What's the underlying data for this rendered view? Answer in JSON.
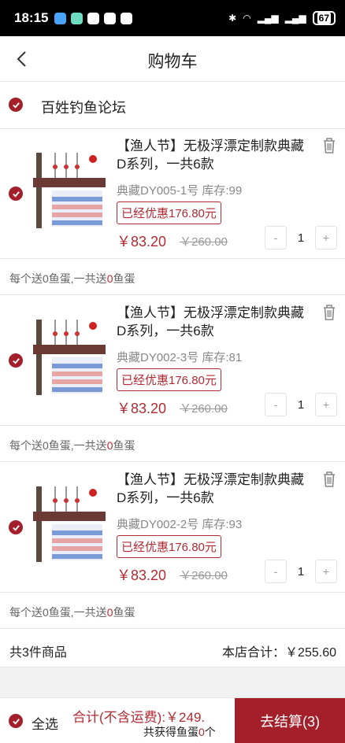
{
  "status_bar": {
    "time": "18:15",
    "battery": "67"
  },
  "header": {
    "title": "购物车"
  },
  "shop": {
    "name": "百姓钓鱼论坛"
  },
  "items": [
    {
      "title": "【渔人节】无极浮漂定制款典藏D系列，一共6款",
      "sku": "典藏DY005-1号 库存:99",
      "discount": "已经优惠176.80元",
      "price": "￥83.20",
      "original_price": "￥260.00",
      "quantity": "1",
      "note_prefix": "每个送0鱼蛋,一共送",
      "note_count": "0",
      "note_suffix": "鱼蛋"
    },
    {
      "title": "【渔人节】无极浮漂定制款典藏D系列，一共6款",
      "sku": "典藏DY002-3号 库存:81",
      "discount": "已经优惠176.80元",
      "price": "￥83.20",
      "original_price": "￥260.00",
      "quantity": "1",
      "note_prefix": "每个送0鱼蛋,一共送",
      "note_count": "0",
      "note_suffix": "鱼蛋"
    },
    {
      "title": "【渔人节】无极浮漂定制款典藏D系列，一共6款",
      "sku": "典藏DY002-2号 库存:93",
      "discount": "已经优惠176.80元",
      "price": "￥83.20",
      "original_price": "￥260.00",
      "quantity": "1",
      "note_prefix": "每个送0鱼蛋,一共送",
      "note_count": "0",
      "note_suffix": "鱼蛋"
    }
  ],
  "stepper": {
    "minus": "-",
    "plus": "+"
  },
  "subtotal": {
    "count_label": "共3件商品",
    "shop_total": "本店合计：￥255.60"
  },
  "footer": {
    "select_all": "全选",
    "total": "合计(不含运费):￥249.",
    "egg_prefix": "共获得鱼蛋",
    "egg_count": "0",
    "egg_suffix": "个",
    "checkout": "去结算(3)"
  },
  "colors": {
    "accent": "#a3202a",
    "price": "#b22a33"
  }
}
